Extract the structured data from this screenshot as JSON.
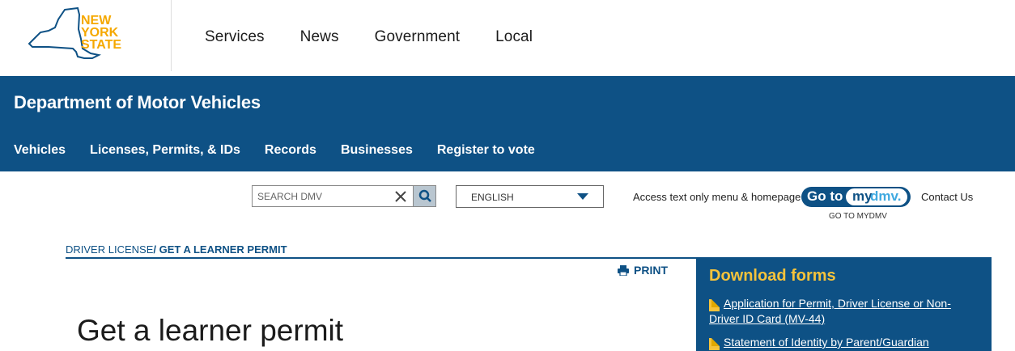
{
  "logo": {
    "line1": "NEW",
    "line2": "YORK",
    "line3": "STATE",
    "color": "#f5a800",
    "outline_color": "#0e5185"
  },
  "top_nav": [
    "Services",
    "News",
    "Government",
    "Local"
  ],
  "agency": {
    "title": "Department of Motor Vehicles",
    "nav": [
      "Vehicles",
      "Licenses, Permits, & IDs",
      "Records",
      "Businesses",
      "Register to vote"
    ],
    "bg_color": "#0e5185"
  },
  "search": {
    "placeholder": "SEARCH DMV",
    "clear_icon": "close-icon",
    "search_icon": "search-icon"
  },
  "language": {
    "selected": "ENGLISH"
  },
  "utility": {
    "access_link": "Access text only menu & homepage",
    "mydmv_goto": "Go to",
    "mydmv_my": "my",
    "mydmv_dmv": "dmv.",
    "mydmv_caption": "GO TO MYDMV",
    "contact": "Contact Us"
  },
  "breadcrumb": {
    "parent": "DRIVER LICENSE",
    "separator": "/ ",
    "current": "GET A LEARNER PERMIT"
  },
  "print_label": "PRINT",
  "page_title": "Get a learner permit",
  "sidebar": {
    "heading": "Download forms",
    "heading_color": "#f5c33b",
    "forms": [
      "Application for Permit, Driver License or Non-Driver ID Card (MV-44)",
      "Statement of Identity by Parent/Guardian"
    ]
  }
}
